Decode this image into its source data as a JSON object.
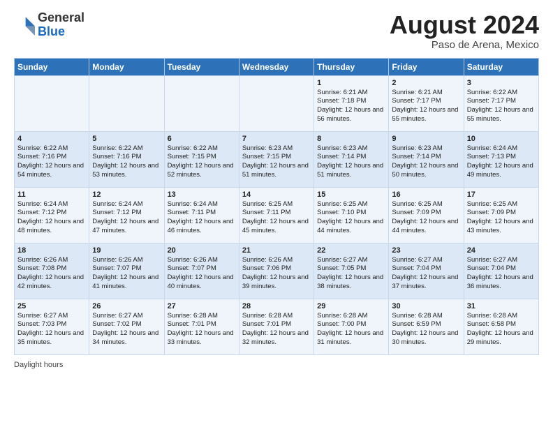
{
  "header": {
    "logo_general": "General",
    "logo_blue": "Blue",
    "month_year": "August 2024",
    "location": "Paso de Arena, Mexico"
  },
  "footer": {
    "daylight_label": "Daylight hours"
  },
  "days_of_week": [
    "Sunday",
    "Monday",
    "Tuesday",
    "Wednesday",
    "Thursday",
    "Friday",
    "Saturday"
  ],
  "weeks": [
    [
      {
        "day": "",
        "info": ""
      },
      {
        "day": "",
        "info": ""
      },
      {
        "day": "",
        "info": ""
      },
      {
        "day": "",
        "info": ""
      },
      {
        "day": "1",
        "info": "Sunrise: 6:21 AM\nSunset: 7:18 PM\nDaylight: 12 hours\nand 56 minutes."
      },
      {
        "day": "2",
        "info": "Sunrise: 6:21 AM\nSunset: 7:17 PM\nDaylight: 12 hours\nand 55 minutes."
      },
      {
        "day": "3",
        "info": "Sunrise: 6:22 AM\nSunset: 7:17 PM\nDaylight: 12 hours\nand 55 minutes."
      }
    ],
    [
      {
        "day": "4",
        "info": "Sunrise: 6:22 AM\nSunset: 7:16 PM\nDaylight: 12 hours\nand 54 minutes."
      },
      {
        "day": "5",
        "info": "Sunrise: 6:22 AM\nSunset: 7:16 PM\nDaylight: 12 hours\nand 53 minutes."
      },
      {
        "day": "6",
        "info": "Sunrise: 6:22 AM\nSunset: 7:15 PM\nDaylight: 12 hours\nand 52 minutes."
      },
      {
        "day": "7",
        "info": "Sunrise: 6:23 AM\nSunset: 7:15 PM\nDaylight: 12 hours\nand 51 minutes."
      },
      {
        "day": "8",
        "info": "Sunrise: 6:23 AM\nSunset: 7:14 PM\nDaylight: 12 hours\nand 51 minutes."
      },
      {
        "day": "9",
        "info": "Sunrise: 6:23 AM\nSunset: 7:14 PM\nDaylight: 12 hours\nand 50 minutes."
      },
      {
        "day": "10",
        "info": "Sunrise: 6:24 AM\nSunset: 7:13 PM\nDaylight: 12 hours\nand 49 minutes."
      }
    ],
    [
      {
        "day": "11",
        "info": "Sunrise: 6:24 AM\nSunset: 7:12 PM\nDaylight: 12 hours\nand 48 minutes."
      },
      {
        "day": "12",
        "info": "Sunrise: 6:24 AM\nSunset: 7:12 PM\nDaylight: 12 hours\nand 47 minutes."
      },
      {
        "day": "13",
        "info": "Sunrise: 6:24 AM\nSunset: 7:11 PM\nDaylight: 12 hours\nand 46 minutes."
      },
      {
        "day": "14",
        "info": "Sunrise: 6:25 AM\nSunset: 7:11 PM\nDaylight: 12 hours\nand 45 minutes."
      },
      {
        "day": "15",
        "info": "Sunrise: 6:25 AM\nSunset: 7:10 PM\nDaylight: 12 hours\nand 44 minutes."
      },
      {
        "day": "16",
        "info": "Sunrise: 6:25 AM\nSunset: 7:09 PM\nDaylight: 12 hours\nand 44 minutes."
      },
      {
        "day": "17",
        "info": "Sunrise: 6:25 AM\nSunset: 7:09 PM\nDaylight: 12 hours\nand 43 minutes."
      }
    ],
    [
      {
        "day": "18",
        "info": "Sunrise: 6:26 AM\nSunset: 7:08 PM\nDaylight: 12 hours\nand 42 minutes."
      },
      {
        "day": "19",
        "info": "Sunrise: 6:26 AM\nSunset: 7:07 PM\nDaylight: 12 hours\nand 41 minutes."
      },
      {
        "day": "20",
        "info": "Sunrise: 6:26 AM\nSunset: 7:07 PM\nDaylight: 12 hours\nand 40 minutes."
      },
      {
        "day": "21",
        "info": "Sunrise: 6:26 AM\nSunset: 7:06 PM\nDaylight: 12 hours\nand 39 minutes."
      },
      {
        "day": "22",
        "info": "Sunrise: 6:27 AM\nSunset: 7:05 PM\nDaylight: 12 hours\nand 38 minutes."
      },
      {
        "day": "23",
        "info": "Sunrise: 6:27 AM\nSunset: 7:04 PM\nDaylight: 12 hours\nand 37 minutes."
      },
      {
        "day": "24",
        "info": "Sunrise: 6:27 AM\nSunset: 7:04 PM\nDaylight: 12 hours\nand 36 minutes."
      }
    ],
    [
      {
        "day": "25",
        "info": "Sunrise: 6:27 AM\nSunset: 7:03 PM\nDaylight: 12 hours\nand 35 minutes."
      },
      {
        "day": "26",
        "info": "Sunrise: 6:27 AM\nSunset: 7:02 PM\nDaylight: 12 hours\nand 34 minutes."
      },
      {
        "day": "27",
        "info": "Sunrise: 6:28 AM\nSunset: 7:01 PM\nDaylight: 12 hours\nand 33 minutes."
      },
      {
        "day": "28",
        "info": "Sunrise: 6:28 AM\nSunset: 7:01 PM\nDaylight: 12 hours\nand 32 minutes."
      },
      {
        "day": "29",
        "info": "Sunrise: 6:28 AM\nSunset: 7:00 PM\nDaylight: 12 hours\nand 31 minutes."
      },
      {
        "day": "30",
        "info": "Sunrise: 6:28 AM\nSunset: 6:59 PM\nDaylight: 12 hours\nand 30 minutes."
      },
      {
        "day": "31",
        "info": "Sunrise: 6:28 AM\nSunset: 6:58 PM\nDaylight: 12 hours\nand 29 minutes."
      }
    ]
  ]
}
